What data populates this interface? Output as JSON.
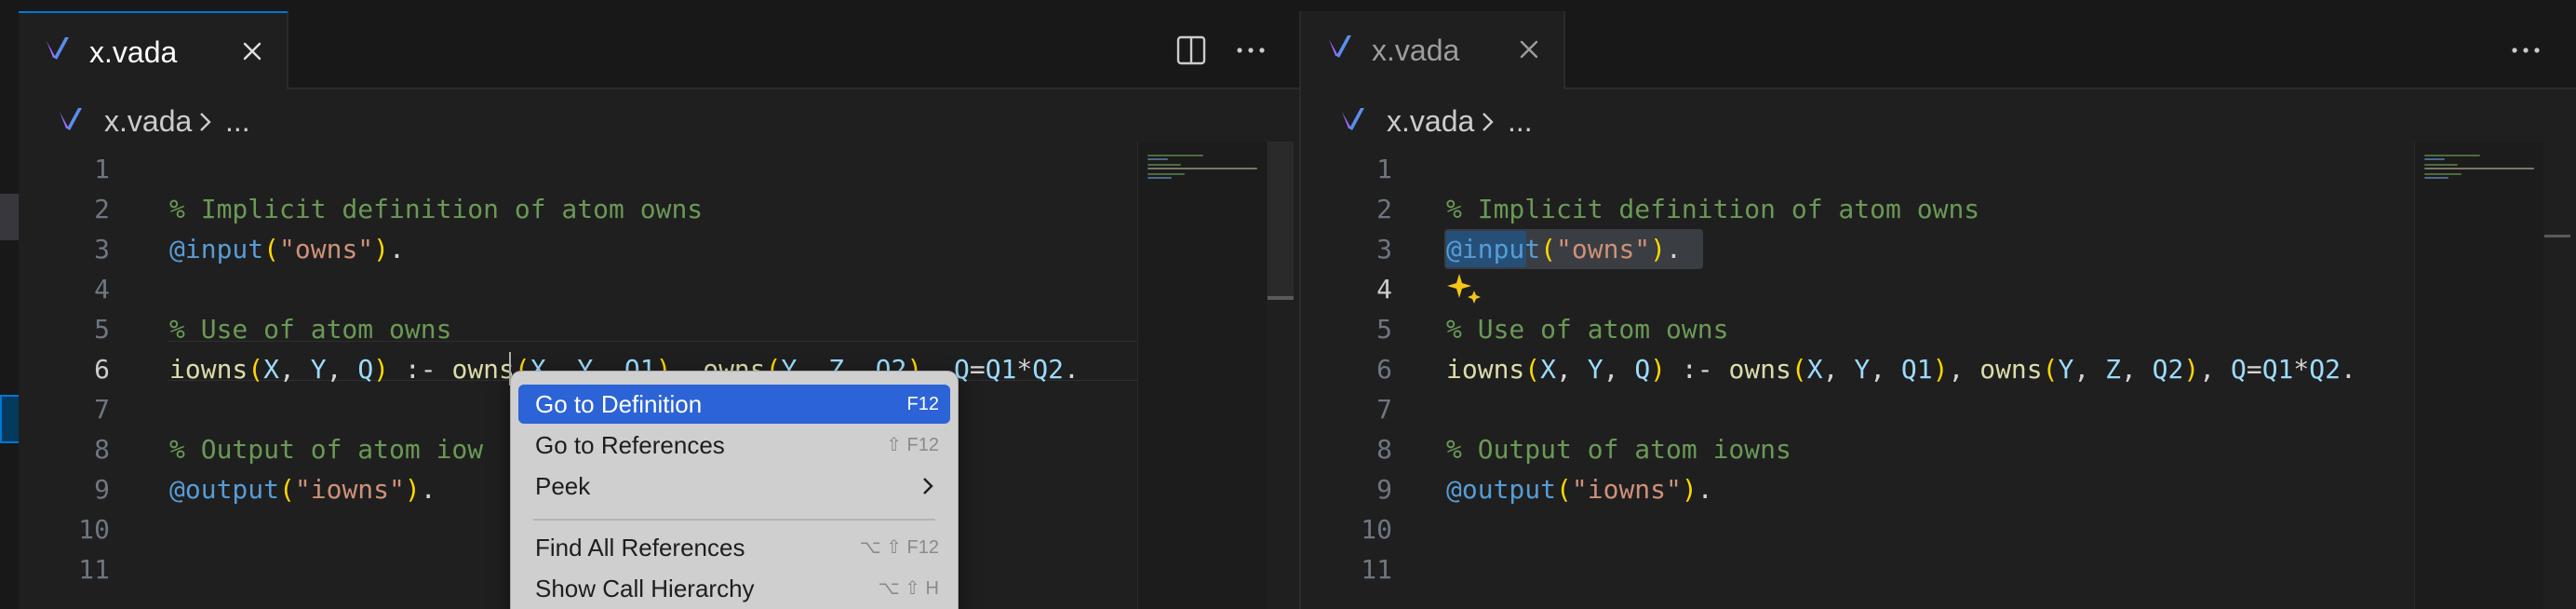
{
  "left_editor": {
    "tab": {
      "filename": "x.vada"
    },
    "breadcrumb": {
      "file": "x.vada",
      "tail": "..."
    },
    "current_line": 6,
    "line_numbers": [
      "1",
      "2",
      "3",
      "4",
      "5",
      "6",
      "7",
      "8",
      "9",
      "10",
      "11"
    ]
  },
  "right_editor": {
    "tab": {
      "filename": "x.vada"
    },
    "breadcrumb": {
      "file": "x.vada",
      "tail": "..."
    },
    "current_line": 4,
    "line_numbers": [
      "1",
      "2",
      "3",
      "4",
      "5",
      "6",
      "7",
      "8",
      "9",
      "10",
      "11"
    ]
  },
  "code": {
    "line2": "% Implicit definition of atom owns",
    "line3": {
      "decorator": "@input",
      "open": "(",
      "string": "\"owns\"",
      "close": ")",
      "end": "."
    },
    "line5": "% Use of atom owns",
    "line6": {
      "head": "iowns",
      "p1": "(",
      "a1": "X",
      "c1": ", ",
      "a2": "Y",
      "c2": ", ",
      "a3": "Q",
      "p2": ")",
      "op": " :- ",
      "b1": "owns",
      "p3": "(",
      "b1a1": "X",
      "c3": ", ",
      "b1a2": "Y",
      "c4": ", ",
      "b1a3": "Q1",
      "p4": ")",
      "c5": ", ",
      "b2": "owns",
      "p5": "(",
      "b2a1": "Y",
      "c6": ", ",
      "b2a2": "Z",
      "c7": ", ",
      "b2a3": "Q2",
      "p6": ")",
      "c8": ", ",
      "lhs": "Q",
      "eq": "=",
      "r1": "Q1",
      "mul": "*",
      "r2": "Q2",
      "end": "."
    },
    "line8": "% Output of atom iowns",
    "line8_left_visible": "% Output of atom iow",
    "line9": {
      "decorator": "@output",
      "open": "(",
      "string": "\"iowns\"",
      "close": ")",
      "end": "."
    }
  },
  "context_menu": {
    "items": [
      {
        "label": "Go to Definition",
        "shortcut": "F12",
        "selected": true
      },
      {
        "label": "Go to References",
        "shortcut": "⇧ F12"
      },
      {
        "label": "Peek",
        "submenu": true
      },
      {
        "label": "Find All References",
        "shortcut": "⌥ ⇧ F12"
      },
      {
        "label": "Show Call Hierarchy",
        "shortcut": "⌥ ⇧ H"
      }
    ]
  },
  "icons": {
    "file": "vada-logo-icon",
    "close": "close-icon",
    "split": "split-editor-icon",
    "more": "more-actions-icon",
    "chevron": "chevron-right-icon",
    "sparkle": "sparkle-icon"
  },
  "colors": {
    "accent": "#0078d4",
    "menu_selected": "#2c63d6",
    "comment": "#6a9955"
  }
}
